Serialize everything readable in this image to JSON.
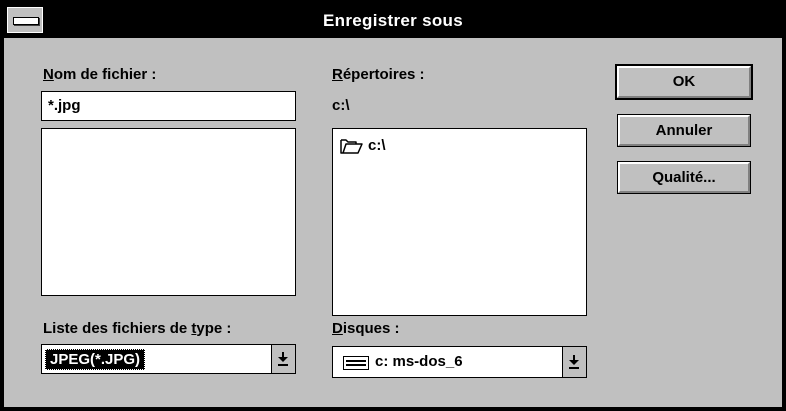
{
  "window": {
    "title": "Enregistrer sous"
  },
  "filename": {
    "label_u": "N",
    "label_rest": "om de fichier :",
    "value": "*.jpg",
    "files": []
  },
  "directories": {
    "label_u": "R",
    "label_rest": "épertoires :",
    "current_path": "c:\\",
    "items": [
      {
        "name": "c:\\",
        "icon": "open-folder-icon"
      }
    ]
  },
  "filetype": {
    "label_before": "Liste des fichiers de ",
    "label_u": "t",
    "label_after": "ype :",
    "selected": "JPEG(*.JPG)"
  },
  "drives": {
    "label_u": "D",
    "label_rest": "isques :",
    "selected": "c: ms-dos_6",
    "icon": "drive-icon"
  },
  "buttons": {
    "ok": "OK",
    "cancel": "Annuler",
    "quality": "Qualité..."
  }
}
